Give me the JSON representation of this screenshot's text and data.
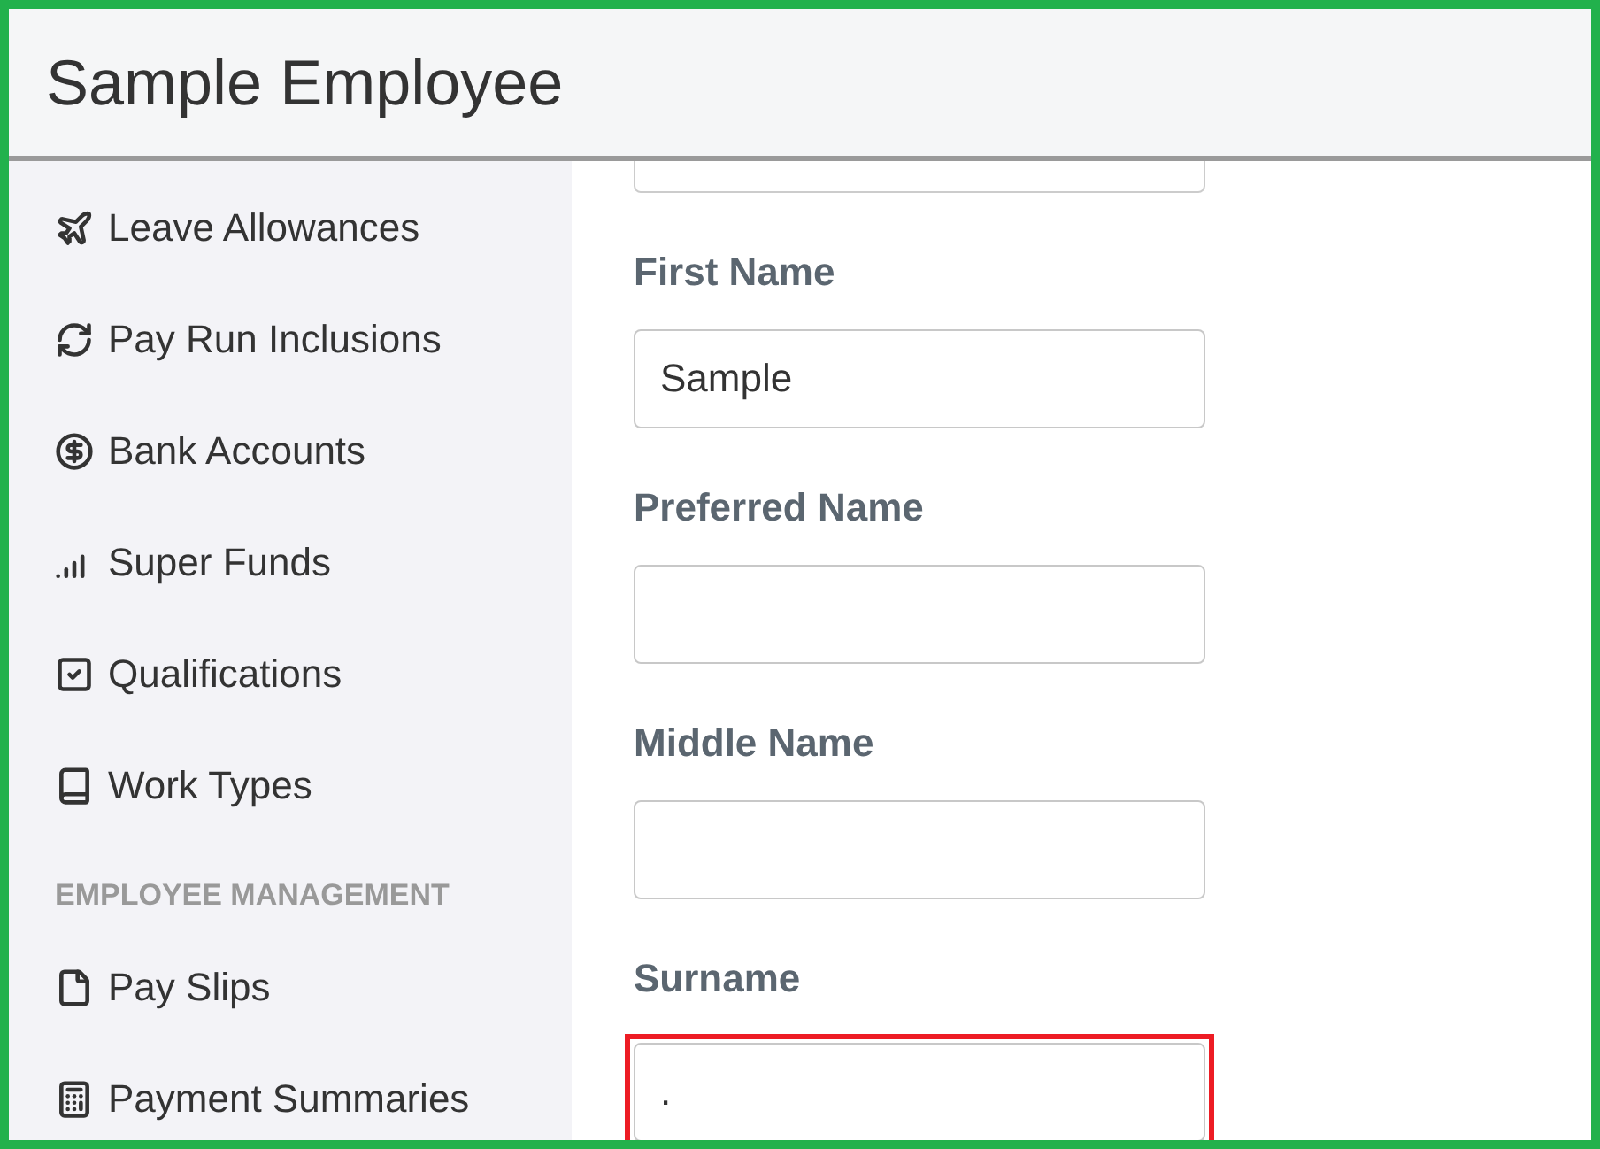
{
  "window": {
    "title": "Sample Employee"
  },
  "sidebar": [
    {
      "kind": "item",
      "label": "Leave Allowances"
    },
    {
      "kind": "item",
      "label": "Pay Run Inclusions"
    },
    {
      "kind": "item",
      "label": "Bank Accounts"
    },
    {
      "kind": "item",
      "label": "Super Funds"
    },
    {
      "kind": "item",
      "label": "Qualifications"
    },
    {
      "kind": "item",
      "label": "Work Types"
    },
    {
      "kind": "heading",
      "label": "EMPLOYEE MANAGEMENT"
    },
    {
      "kind": "item",
      "label": "Pay Slips"
    },
    {
      "kind": "item",
      "label": "Payment Summaries"
    }
  ],
  "form": {
    "fields": [
      {
        "label": "First Name",
        "value": "Sample",
        "highlighted": false
      },
      {
        "label": "Preferred Name",
        "highlighted": false
      },
      {
        "label": "Middle Name",
        "highlighted": false
      },
      {
        "label": "Surname",
        "value": ".",
        "highlighted": true
      }
    ]
  }
}
